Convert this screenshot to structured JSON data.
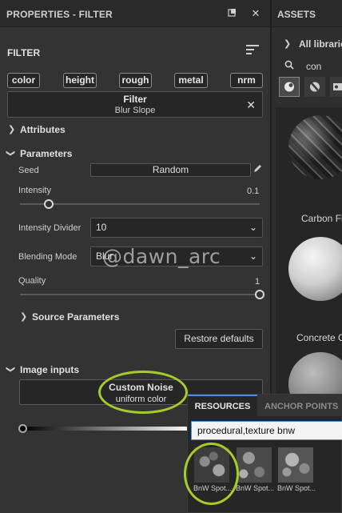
{
  "left_panel": {
    "title": "PROPERTIES - FILTER",
    "section": "FILTER",
    "channels": [
      "color",
      "height",
      "rough",
      "metal",
      "nrm"
    ],
    "filter_box": {
      "title": "Filter",
      "subtitle": "Blur Slope"
    },
    "attributes_label": "Attributes",
    "parameters_label": "Parameters",
    "seed": {
      "label": "Seed",
      "value": "Random"
    },
    "intensity": {
      "label": "Intensity",
      "value": "0.1",
      "fraction": 0.12
    },
    "intensity_divider": {
      "label": "Intensity Divider",
      "value": "10"
    },
    "blending_mode": {
      "label": "Blending Mode",
      "value": "Blur"
    },
    "quality": {
      "label": "Quality",
      "value": "1",
      "fraction": 1.0
    },
    "source_parameters_label": "Source Parameters",
    "restore_label": "Restore defaults",
    "image_inputs_label": "Image inputs",
    "custom_noise": {
      "title": "Custom Noise",
      "subtitle": "uniform color"
    }
  },
  "right_panel": {
    "title": "ASSETS",
    "breadcrumb": "All librarie",
    "search_value": "con",
    "assets": [
      {
        "label": "Carbon Fi"
      },
      {
        "label": "Concrete C"
      }
    ]
  },
  "resources_popup": {
    "tabs": [
      "RESOURCES",
      "ANCHOR POINTS"
    ],
    "search_value": "procedural,texture bnw",
    "items": [
      "BnW Spot...",
      "BnW Spot...",
      "BnW Spot..."
    ]
  },
  "watermark": "@dawn_arc",
  "colors": {
    "highlight_ring": "#a7cb2a",
    "active_tab_border": "#4a90d9"
  }
}
